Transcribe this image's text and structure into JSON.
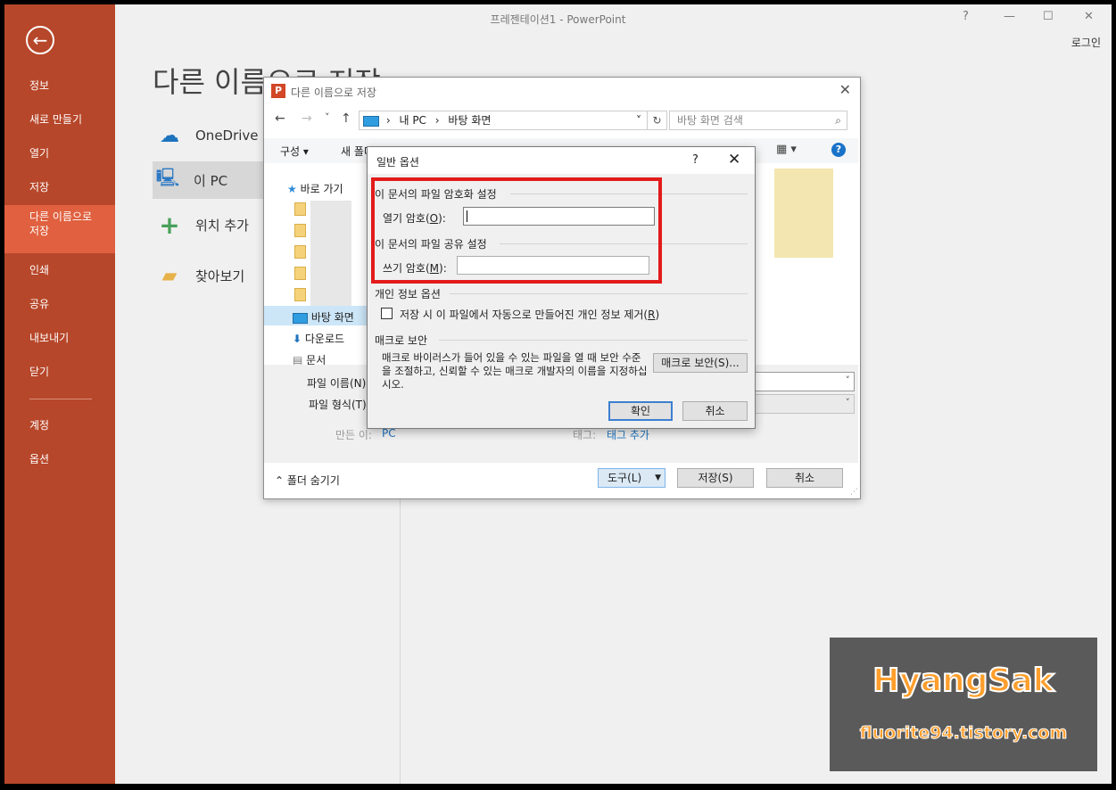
{
  "window": {
    "title": "프레젠테이션1 - PowerPoint",
    "help": "?",
    "minimize": "—",
    "maximize": "☐",
    "close": "✕",
    "login": "로그인"
  },
  "sidebar": {
    "back": "←",
    "items": [
      {
        "label": "정보"
      },
      {
        "label": "새로 만들기"
      },
      {
        "label": "열기"
      },
      {
        "label": "저장"
      },
      {
        "label": "다른 이름으로\n저장"
      },
      {
        "label": "인쇄"
      },
      {
        "label": "공유"
      },
      {
        "label": "내보내기"
      },
      {
        "label": "닫기"
      },
      {
        "label": "계정"
      },
      {
        "label": "옵션"
      }
    ],
    "active_index": 4
  },
  "main": {
    "title": "다른 이름으로 저장",
    "locations": [
      {
        "label": "OneDrive",
        "icon": "cloud-icon"
      },
      {
        "label": "이 PC",
        "icon": "computer-icon"
      },
      {
        "label": "위치 추가",
        "icon": "plus-icon"
      },
      {
        "label": "찾아보기",
        "icon": "folder-icon"
      }
    ]
  },
  "save_dialog": {
    "title": "다른 이름으로 저장",
    "logo_letter": "P",
    "close": "✕",
    "nav": {
      "back": "←",
      "forward": "→",
      "recent": "˅",
      "up": "↑"
    },
    "address": {
      "parts": [
        "내 PC",
        "바탕 화면"
      ],
      "sep": "›",
      "dropdown": "˅",
      "refresh": "↻"
    },
    "search_placeholder": "바탕 화면 검색",
    "search_icon": "⌕",
    "toolbar": {
      "organize": "구성 ▾",
      "new_folder": "새 폴더",
      "view": "▦ ▾",
      "help": "?"
    },
    "tree": {
      "quick_access": "바로 가기",
      "desktop": "바탕 화면",
      "downloads": "다운로드",
      "documents": "문서"
    },
    "form": {
      "filename_label": "파일 이름(N):",
      "filetype_label": "파일 형식(T):",
      "authors_label": "만든 이:",
      "authors_value": "PC",
      "tags_label": "태그:",
      "tags_value": "태그 추가"
    },
    "hide_folders": "⌃  폴더 숨기기",
    "buttons": {
      "tools": "도구(L)",
      "tools_arrow": "▼",
      "save": "저장(S)",
      "cancel": "취소"
    }
  },
  "general_options": {
    "title": "일반 옵션",
    "help": "?",
    "close": "✕",
    "encrypt_section": "이 문서의 파일 암호화 설정",
    "open_pw_label_a": "열기 암호(",
    "open_pw_key": "O",
    "open_pw_label_b": "):",
    "share_section": "이 문서의 파일 공유 설정",
    "write_pw_label_a": "쓰기 암호(",
    "write_pw_key": "M",
    "write_pw_label_b": "):",
    "privacy_section": "개인 정보 옵션",
    "privacy_checkbox_label_a": "저장 시 이 파일에서 자동으로 만들어진 개인 정보 제거(",
    "privacy_checkbox_key": "R",
    "privacy_checkbox_label_b": ")",
    "privacy_checked": false,
    "macro_section": "매크로 보안",
    "macro_text": "매크로 바이러스가 들어 있을 수 있는 파일을 열 때 보안 수준을 조절하고, 신뢰할 수 있는 매크로 개발자의 이름을 지정하십시오.",
    "macro_button": "매크로 보안(S)...",
    "ok": "확인",
    "cancel": "취소"
  },
  "watermark": {
    "title": "HyangSak",
    "url": "fluorite94.tistory.com"
  },
  "colors": {
    "backstage": "#b7472a",
    "backstage_active": "#e0603f",
    "highlight": "#e31b1b",
    "watermark_text": "#ff9e2c"
  }
}
